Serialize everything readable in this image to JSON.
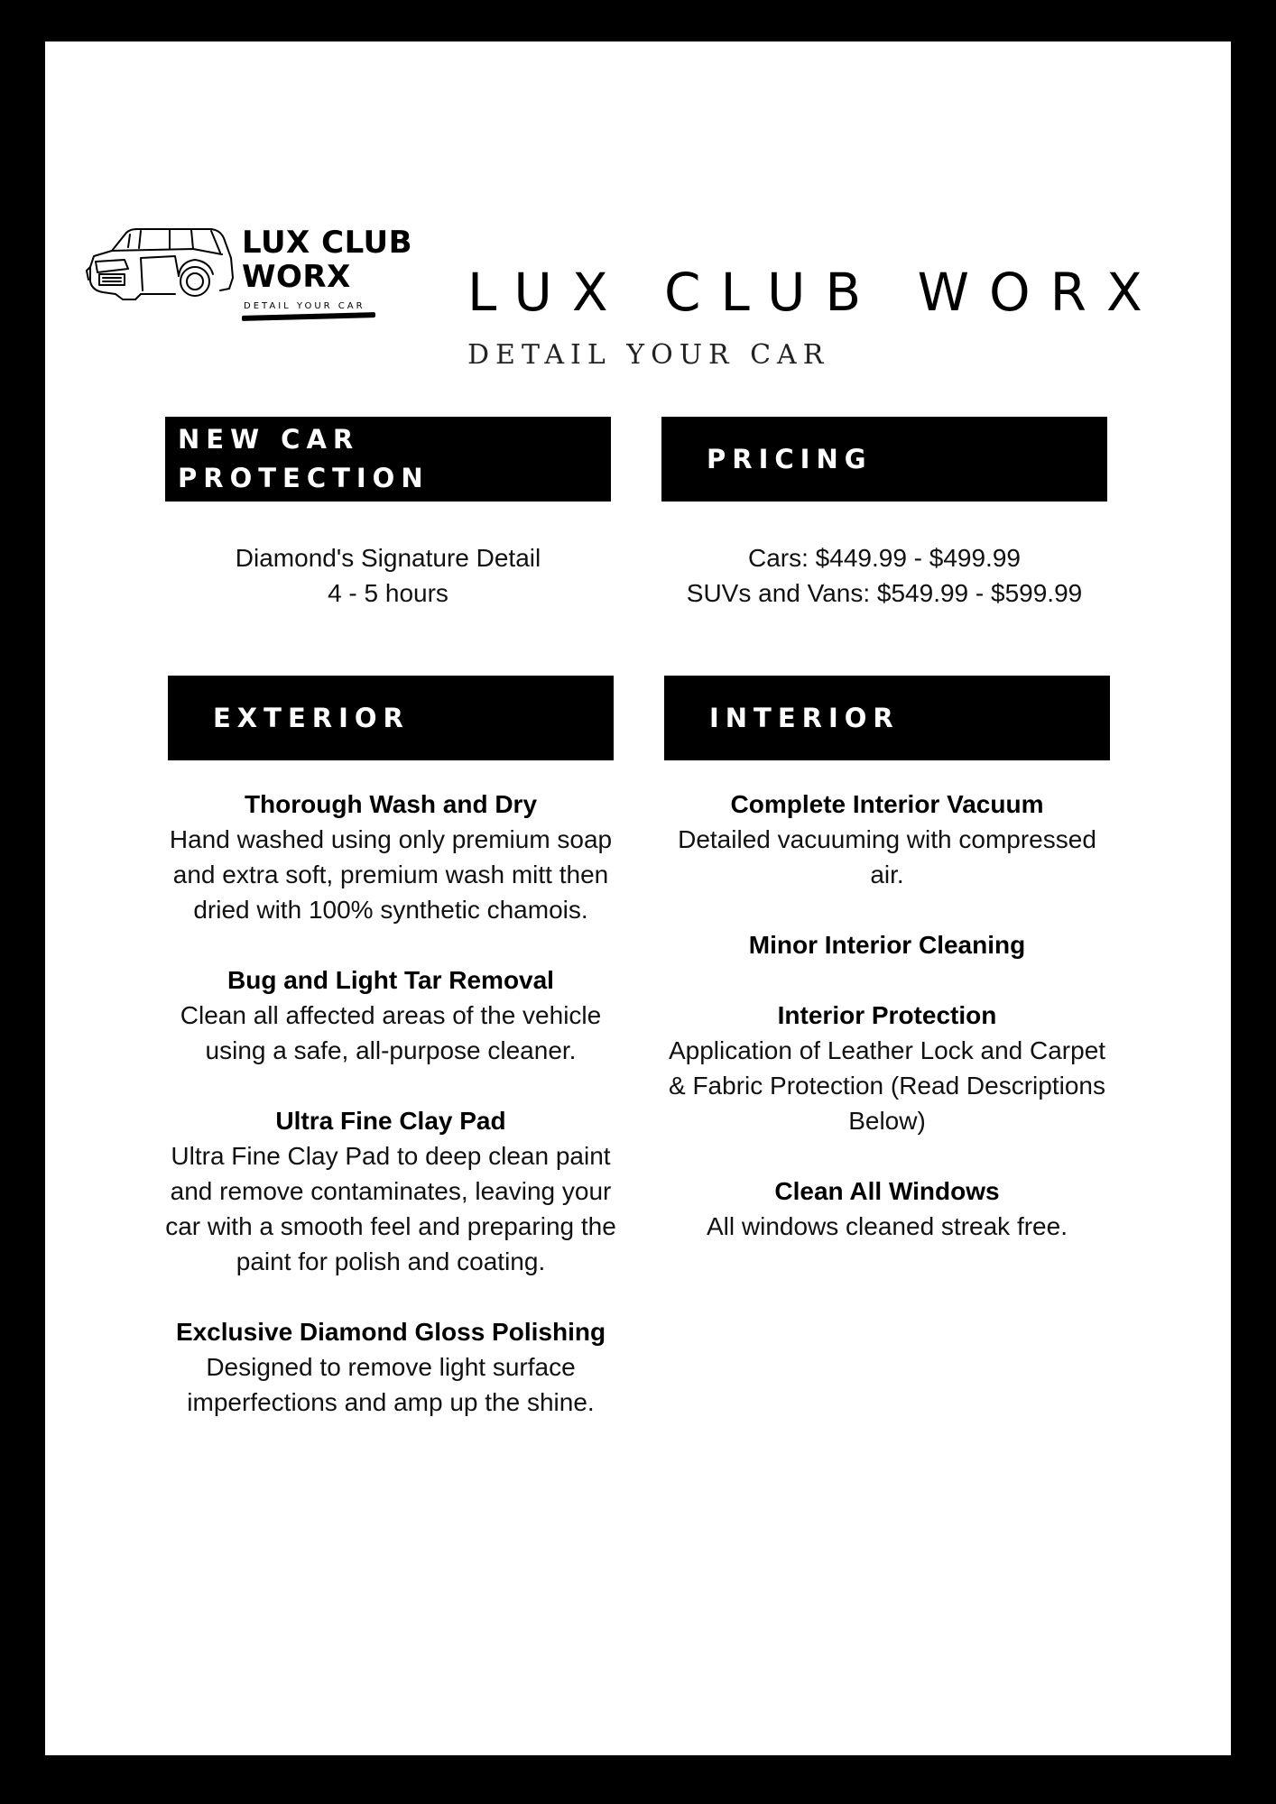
{
  "logo": {
    "line1": "LUX CLUB",
    "line2": "WORX",
    "tagline": "DETAIL YOUR CAR"
  },
  "header": {
    "title": "LUX CLUB WORX",
    "subtitle": "DETAIL YOUR CAR"
  },
  "sections": {
    "new_car_protection": {
      "heading_line1": "NEW CAR",
      "heading_line2": "PROTECTION",
      "lines": [
        "Diamond's Signature Detail",
        "4 - 5 hours"
      ]
    },
    "pricing": {
      "heading": "PRICING",
      "lines": [
        "Cars: $449.99 - $499.99",
        "SUVs and Vans: $549.99 - $599.99"
      ]
    },
    "exterior": {
      "heading": "EXTERIOR",
      "items": [
        {
          "title": "Thorough Wash and Dry",
          "desc": "Hand washed using only premium soap and extra soft, premium wash mitt then dried with 100% synthetic chamois."
        },
        {
          "title": "Bug and Light Tar Removal",
          "desc": "Clean all affected areas of the vehicle using a safe, all-purpose cleaner."
        },
        {
          "title": "Ultra Fine Clay Pad",
          "desc": "Ultra Fine Clay Pad to deep clean paint and remove contaminates, leaving your car with a smooth feel and preparing the paint for polish and coating."
        },
        {
          "title": "Exclusive Diamond Gloss Polishing",
          "desc": "Designed to remove light surface imperfections and amp up the shine."
        }
      ]
    },
    "interior": {
      "heading": "INTERIOR",
      "items": [
        {
          "title": "Complete Interior Vacuum",
          "desc": "Detailed vacuuming with compressed air."
        },
        {
          "title": "Minor Interior Cleaning",
          "desc": ""
        },
        {
          "title": "Interior Protection",
          "desc": "Application of Leather Lock and Carpet & Fabric Protection (Read Descriptions Below)"
        },
        {
          "title": "Clean All Windows",
          "desc": "All windows cleaned streak free."
        }
      ]
    }
  }
}
